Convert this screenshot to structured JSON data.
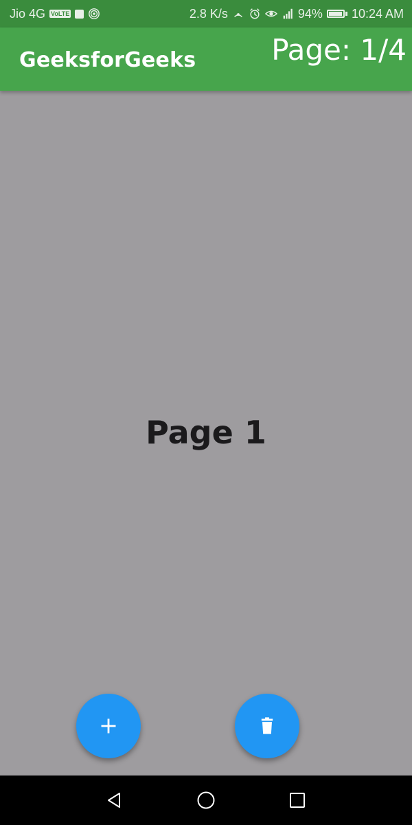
{
  "status_bar": {
    "carrier": "Jio 4G",
    "volte": "VoLTE",
    "speed": "2.8 K/s",
    "battery_percent": "94%",
    "battery_level": 0.94,
    "time": "10:24 AM",
    "icons": [
      "stop-square-icon",
      "hotspot-icon",
      "wifi-hotspot-icon",
      "alarm-icon",
      "eye-icon",
      "signal-icon",
      "battery-charging-icon"
    ]
  },
  "app_bar": {
    "title": "GeeksforGeeks",
    "page_indicator": "Page: 1/4",
    "color": "#47a54c"
  },
  "content": {
    "page_label": "Page 1",
    "background": "#9e9c9f"
  },
  "fabs": {
    "add_icon": "plus-icon",
    "delete_icon": "trash-icon",
    "color": "#2196f3"
  },
  "nav_bar": {
    "icons": [
      "back-triangle-icon",
      "home-circle-icon",
      "recents-square-icon"
    ]
  }
}
